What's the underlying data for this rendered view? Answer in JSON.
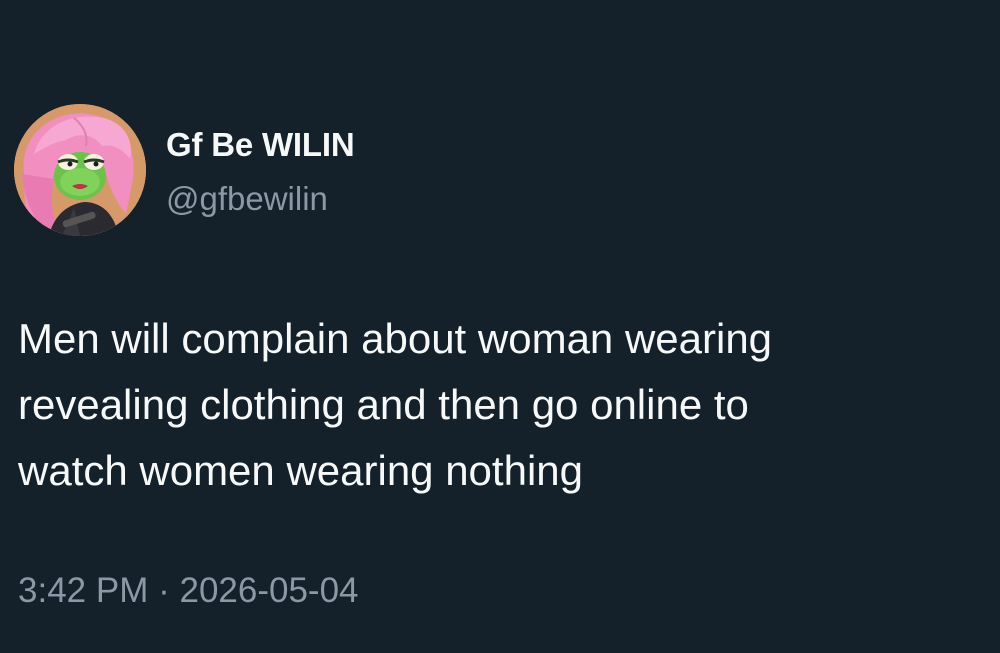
{
  "author": {
    "display_name": "Gf Be WILIN",
    "handle": "@gfbewilin",
    "avatar_icon": "cartoon-frog-avatar-icon"
  },
  "tweet": {
    "lines": [
      "Men will complain about woman wearing",
      "revealing clothing and then go online to",
      "watch women wearing nothing"
    ],
    "time": "3:42 PM",
    "separator": "·",
    "date": "2026-05-04"
  },
  "colors": {
    "background": "#14202a",
    "primary_text": "#f7f9f9",
    "secondary_text": "#8b98a5"
  }
}
